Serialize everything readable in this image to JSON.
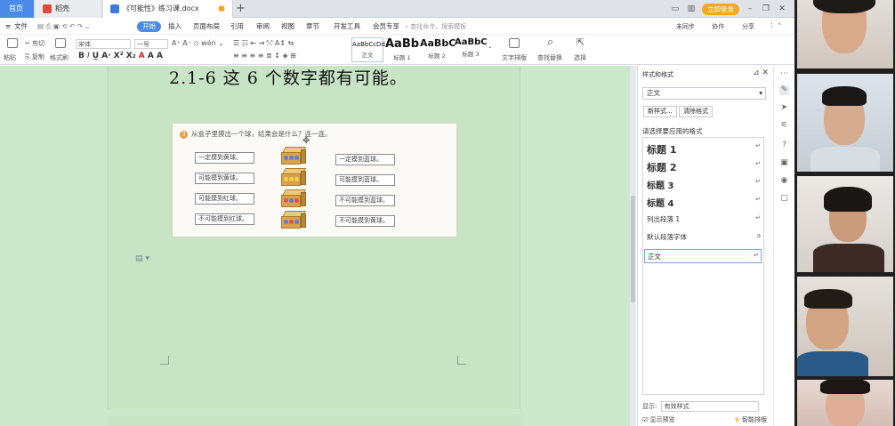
{
  "tabs": {
    "home": "首页",
    "daoke": "稻壳",
    "doc": "《可能性》练习课.docx"
  },
  "window": {
    "login": "立即登录"
  },
  "menubar": {
    "file": "文件",
    "items": [
      "开始",
      "插入",
      "页面布局",
      "引用",
      "审阅",
      "视图",
      "章节",
      "开发工具",
      "会员专享"
    ],
    "search_placeholder": "查找命令、搜索模板",
    "sync": "未同步",
    "collab": "协作",
    "share": "分享"
  },
  "ribbon": {
    "paste": "粘贴",
    "cut": "剪切",
    "copy": "复制",
    "format_painter": "格式刷",
    "font_name": "宋体",
    "font_size": "一号",
    "styles": [
      {
        "preview": "AaBbCcDd",
        "label": "正文"
      },
      {
        "preview": "AaBb",
        "label": "标题 1"
      },
      {
        "preview": "AaBbC",
        "label": "标题 2"
      },
      {
        "preview": "AaBbC",
        "label": "标题 3"
      }
    ],
    "text_layout": "文字排版",
    "find_replace": "查找替换",
    "select": "选择"
  },
  "document": {
    "heading": "2.1-6 这 6 个数字都有可能。",
    "figure": {
      "number": "3",
      "question": "从盒子里摸出一个球，结果会是什么？连一连。",
      "left_labels": [
        "一定摸到黄球。",
        "可能摸到黄球。",
        "可能摸到红球。",
        "不可能摸到红球。"
      ],
      "right_labels": [
        "一定摸到蓝球。",
        "可能摸到蓝球。",
        "不可能摸到蓝球。",
        "不可能摸到黄球。"
      ]
    }
  },
  "styles_pane": {
    "title": "样式和格式",
    "current_style": "正文",
    "new_style": "新样式...",
    "clear_format": "清除格式",
    "apply_prompt": "请选择要应用的格式",
    "list": [
      "标题 1",
      "标题 2",
      "标题 3",
      "标题 4",
      "列出段落 1",
      "默认段落字体",
      "正文"
    ],
    "show_label": "显示:",
    "show_value": "有效样式",
    "preview_label": "显示预览",
    "smart_layout": "智能排版"
  }
}
